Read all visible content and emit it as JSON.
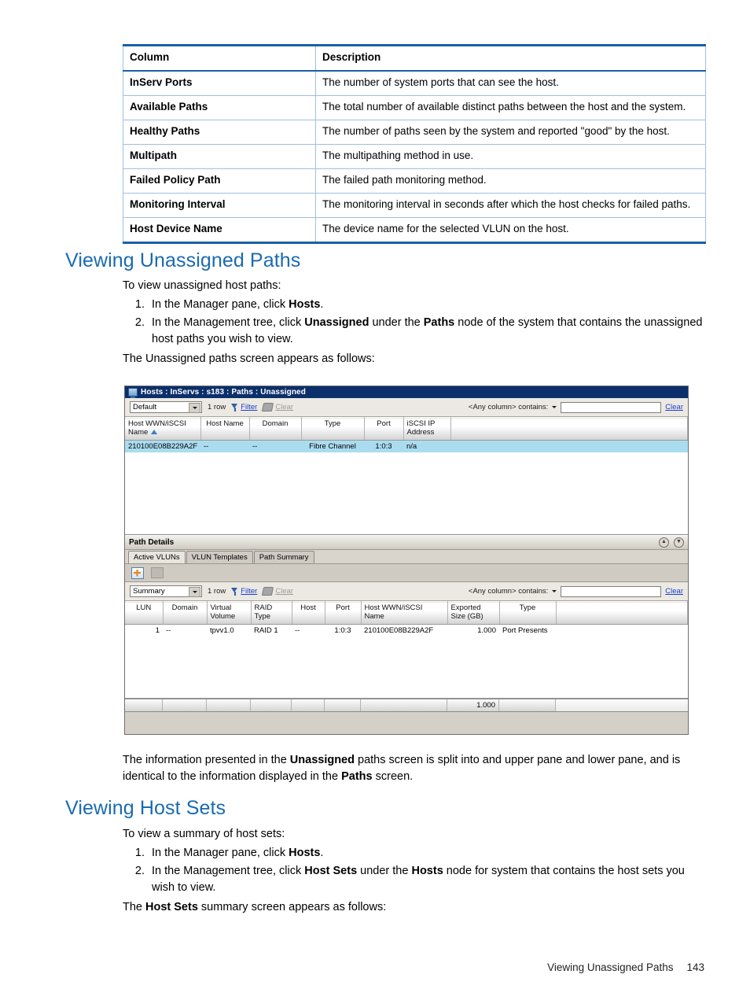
{
  "reference_table": {
    "headers": [
      "Column",
      "Description"
    ],
    "rows": [
      [
        "InServ Ports",
        "The number of system ports that can see the host."
      ],
      [
        "Available Paths",
        "The total number of available distinct paths between the host and the system."
      ],
      [
        "Healthy Paths",
        "The number of paths seen by the system and reported \"good\" by the host."
      ],
      [
        "Multipath",
        "The multipathing method in use."
      ],
      [
        "Failed Policy Path",
        "The failed path monitoring method."
      ],
      [
        "Monitoring Interval",
        "The monitoring interval in seconds after which the host checks for failed paths."
      ],
      [
        "Host Device Name",
        "The device name for the selected VLUN on the host."
      ]
    ]
  },
  "sections": {
    "unassigned": {
      "heading": "Viewing Unassigned Paths",
      "intro": "To view unassigned host paths:",
      "step1_pre": "In the Manager pane, click ",
      "step1_bold": "Hosts",
      "step1_post": ".",
      "step2_pre": "In the Management tree, click ",
      "step2_bold1": "Unassigned",
      "step2_mid": " under the ",
      "step2_bold2": "Paths",
      "step2_post": " node of the system that contains the unassigned host paths you wish to view.",
      "closing": "The Unassigned paths screen appears as follows:",
      "outro_pre": "The information presented in the ",
      "outro_bold1": "Unassigned",
      "outro_mid": " paths screen is split into and upper pane and lower pane, and is identical to the information displayed in the ",
      "outro_bold2": "Paths",
      "outro_post": " screen."
    },
    "hostsets": {
      "heading": "Viewing Host Sets",
      "intro": "To view a summary of host sets:",
      "step1_pre": "In the Manager pane, click ",
      "step1_bold": "Hosts",
      "step1_post": ".",
      "step2_pre": "In the Management tree, click ",
      "step2_bold1": "Host Sets",
      "step2_mid": " under the ",
      "step2_bold2": "Hosts",
      "step2_post": " node for system that contains the host sets you wish to view.",
      "closing_pre": "The ",
      "closing_bold": "Host Sets",
      "closing_post": " summary screen appears as follows:"
    }
  },
  "app_screenshot": {
    "title": "Hosts : InServs : s183 : Paths : Unassigned",
    "upper_toolbar": {
      "view_select": "Default",
      "row_count": "1 row",
      "filter_label": "Filter",
      "clear_label": "Clear",
      "search_label": "<Any column> contains:",
      "search_value": "",
      "search_clear": "Clear"
    },
    "upper_grid": {
      "headers": [
        "Host WWN/iSCSI Name",
        "Host Name",
        "Domain",
        "Type",
        "Port",
        "iSCSI IP Address"
      ],
      "sorted_column": "Host WWN/iSCSI Name",
      "rows": [
        [
          "210100E08B229A2F",
          "--",
          "--",
          "Fibre Channel",
          "1:0:3",
          "n/a"
        ]
      ]
    },
    "path_details": {
      "title": "Path Details",
      "tabs": [
        "Active VLUNs",
        "VLUN Templates",
        "Path Summary"
      ],
      "active_tab": "Active VLUNs",
      "lower_toolbar": {
        "view_select": "Summary",
        "row_count": "1 row",
        "filter_label": "Filter",
        "clear_label": "Clear",
        "search_label": "<Any column> contains:",
        "search_value": "",
        "search_clear": "Clear"
      },
      "lower_grid": {
        "headers": [
          "LUN",
          "Domain",
          "Virtual Volume",
          "RAID Type",
          "Host",
          "Port",
          "Host WWN/iSCSI Name",
          "Exported Size (GB)",
          "Type"
        ],
        "rows": [
          [
            "1",
            "--",
            "tpvv1.0",
            "RAID 1",
            "--",
            "1:0:3",
            "210100E08B229A2F",
            "1.000",
            "Port Presents"
          ]
        ],
        "total_row": {
          "exported_size": "1.000"
        }
      }
    }
  },
  "page_footer": {
    "running_head": "Viewing Unassigned Paths",
    "page_number": "143"
  }
}
